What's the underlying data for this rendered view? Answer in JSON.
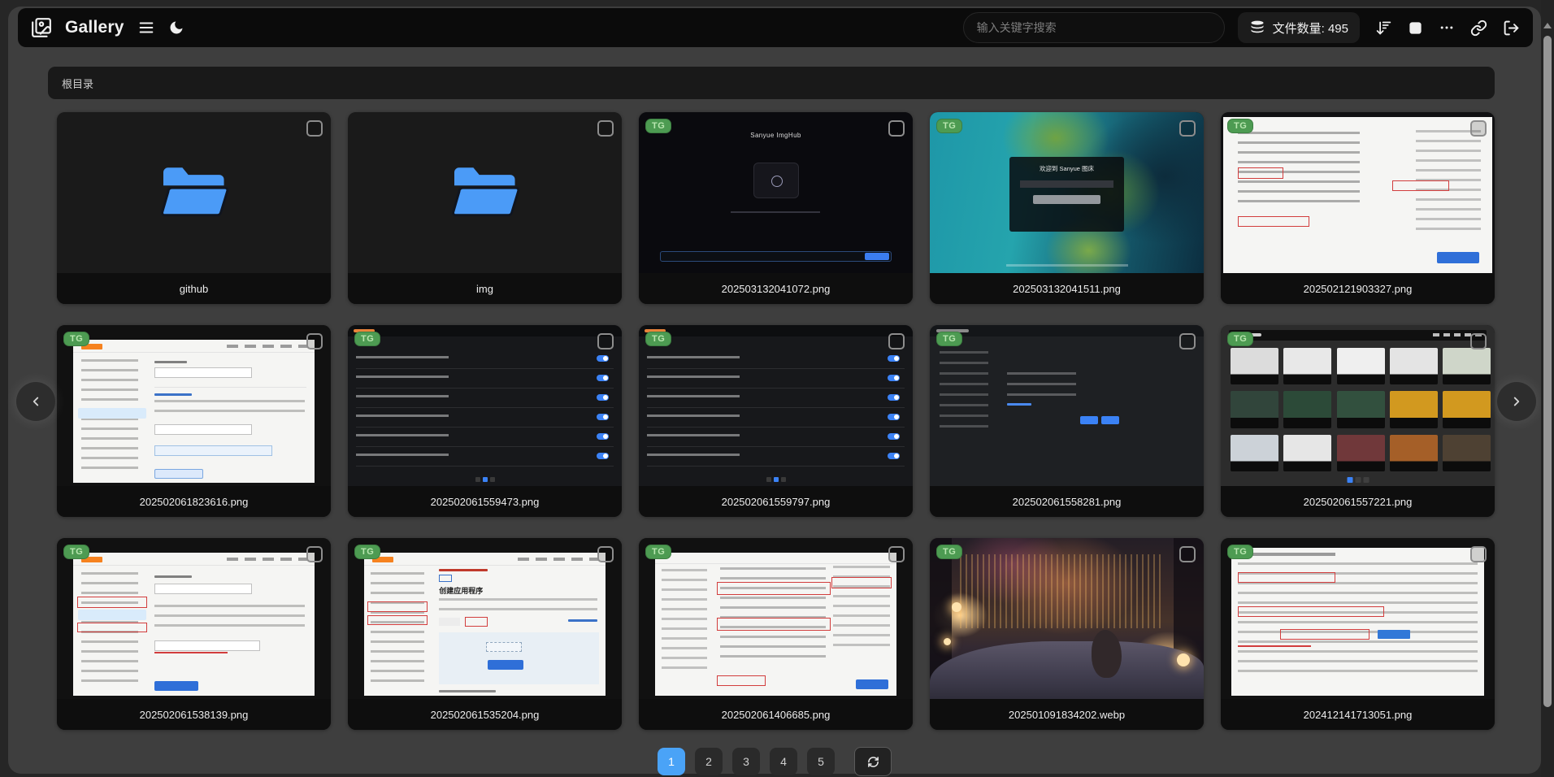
{
  "navbar": {
    "brand": "Gallery",
    "search_placeholder": "输入关键字搜索",
    "file_count": "文件数量: 495",
    "icons": [
      "gallery-logo-icon",
      "hamburger-menu-icon",
      "moon-icon",
      "database-icon",
      "sort-desc-icon",
      "select-square-icon",
      "ellipsis-icon",
      "link-icon",
      "logout-icon"
    ]
  },
  "breadcrumb": {
    "root_label": "根目录"
  },
  "grid": {
    "badge_label": "TG",
    "items": [
      {
        "name": "github",
        "type": "folder"
      },
      {
        "name": "img",
        "type": "folder"
      },
      {
        "name": "202503132041072.png",
        "type": "image"
      },
      {
        "name": "202503132041511.png",
        "type": "image"
      },
      {
        "name": "202502121903327.png",
        "type": "image"
      },
      {
        "name": "202502061823616.png",
        "type": "image"
      },
      {
        "name": "202502061559473.png",
        "type": "image"
      },
      {
        "name": "202502061559797.png",
        "type": "image"
      },
      {
        "name": "202502061558281.png",
        "type": "image"
      },
      {
        "name": "202502061557221.png",
        "type": "image"
      },
      {
        "name": "202502061538139.png",
        "type": "image"
      },
      {
        "name": "202502061535204.png",
        "type": "image"
      },
      {
        "name": "202502061406685.png",
        "type": "image"
      },
      {
        "name": "202501091834202.webp",
        "type": "image"
      },
      {
        "name": "202412141713051.png",
        "type": "image"
      }
    ],
    "thumb_texts": {
      "imghub_title": "Sanyue ImgHub",
      "ocean_login_title": "欢迎到 Sanyue 图床",
      "create_app_heading": "创建应用程序"
    }
  },
  "pagination": {
    "pages": [
      "1",
      "2",
      "3",
      "4",
      "5"
    ],
    "active_page": "1"
  },
  "colors": {
    "accent_blue": "#4aa3f7",
    "folder_blue": "#4b9bf7",
    "badge_green": "#4d9b52"
  }
}
